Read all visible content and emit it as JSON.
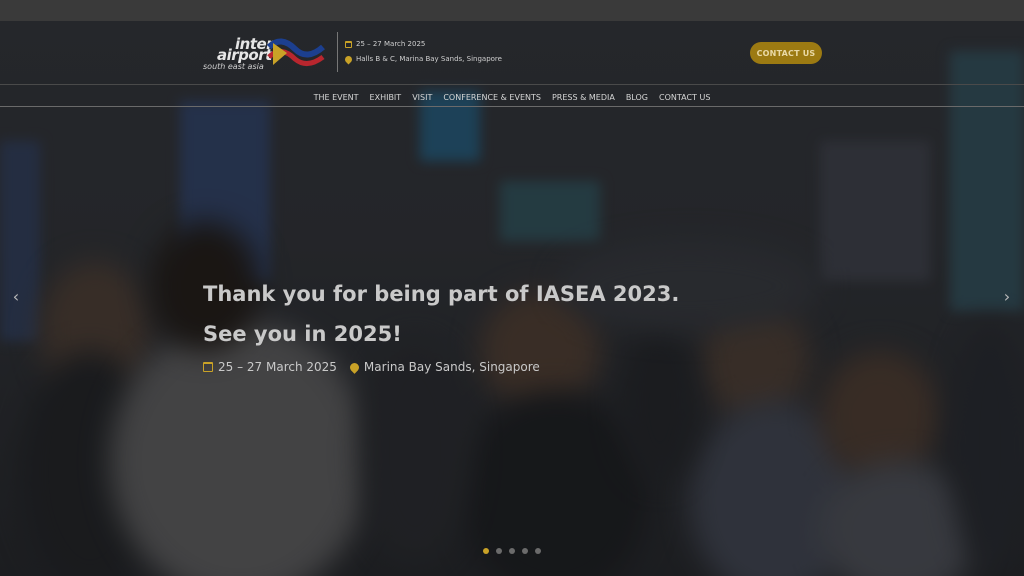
{
  "brand": {
    "logo_line1": "inter",
    "logo_line2": "airport",
    "logo_line3": "south east asia"
  },
  "event_info": {
    "dates": "25 – 27 March 2025",
    "venue": "Halls B & C, Marina Bay Sands, Singapore"
  },
  "header": {
    "contact_button": "CONTACT US"
  },
  "nav": {
    "items": [
      "THE EVENT",
      "EXHIBIT",
      "VISIT",
      "CONFERENCE & EVENTS",
      "PRESS & MEDIA",
      "BLOG",
      "CONTACT US"
    ]
  },
  "hero": {
    "headline": "Thank you for being part of IASEA 2023.",
    "subline": "See you in 2025!",
    "date_text": "25 – 27 March 2025",
    "location_text": "Marina Bay Sands, Singapore"
  },
  "carousel": {
    "prev_icon": "chevron-left-icon",
    "next_icon": "chevron-right-icon",
    "active_index": 0,
    "total_slides": 5
  },
  "colors": {
    "accent": "#c9a227",
    "button_bg": "#9c7a12"
  }
}
